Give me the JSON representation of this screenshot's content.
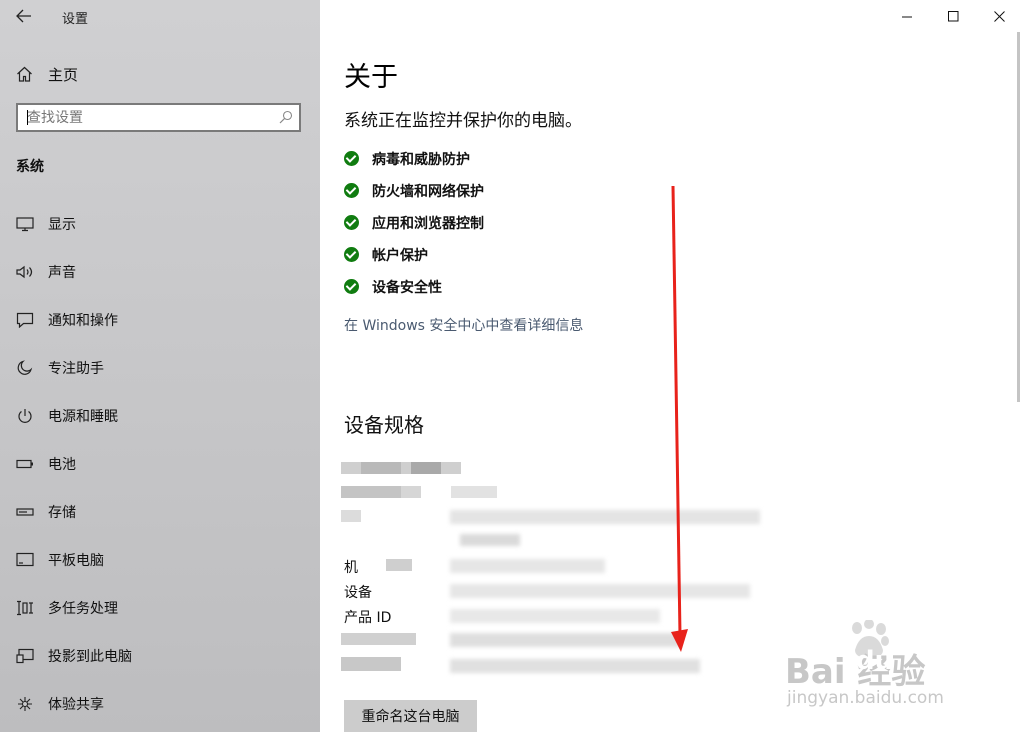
{
  "window": {
    "title": "设置",
    "minimize_glyph": "—",
    "maximize_glyph": "☐",
    "close_glyph": "✕"
  },
  "sidebar": {
    "home_label": "主页",
    "search_placeholder": "查找设置",
    "section_title": "系统",
    "items": [
      {
        "label": "显示",
        "icon": "display-icon"
      },
      {
        "label": "声音",
        "icon": "speaker-icon"
      },
      {
        "label": "通知和操作",
        "icon": "notification-icon"
      },
      {
        "label": "专注助手",
        "icon": "moon-icon"
      },
      {
        "label": "电源和睡眠",
        "icon": "power-icon"
      },
      {
        "label": "电池",
        "icon": "battery-icon"
      },
      {
        "label": "存储",
        "icon": "storage-icon"
      },
      {
        "label": "平板电脑",
        "icon": "tablet-icon"
      },
      {
        "label": "多任务处理",
        "icon": "multitask-icon"
      },
      {
        "label": "投影到此电脑",
        "icon": "project-icon"
      },
      {
        "label": "体验共享",
        "icon": "share-icon"
      }
    ]
  },
  "main": {
    "title": "关于",
    "subtitle": "系统正在监控并保护你的电脑。",
    "protections": [
      "病毒和威胁防护",
      "防火墙和网络保护",
      "应用和浏览器控制",
      "帐户保护",
      "设备安全性"
    ],
    "security_link": "在 Windows 安全中心中查看详细信息",
    "spec_title": "设备规格",
    "spec_labels": [
      "机",
      "设备",
      "产品 ID"
    ],
    "rename_button": "重命名这台电脑"
  },
  "watermark": {
    "brand": "Bai  经验",
    "brand_du": "du",
    "url": "jingyan.baidu.com"
  },
  "colors": {
    "sidebar_bg": "#c9c9cb",
    "check_green": "#107c10",
    "link_color": "#4a5a70",
    "annotation_arrow": "#e8221b"
  }
}
